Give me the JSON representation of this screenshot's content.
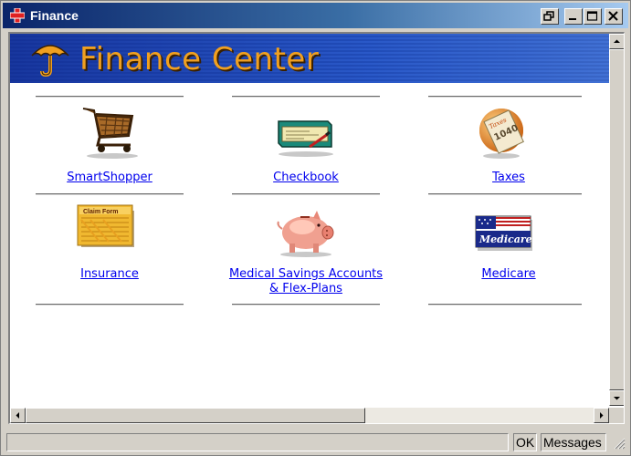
{
  "window": {
    "title": "Finance",
    "title_icon": "red-cross-icon",
    "controls": [
      "restore-icon",
      "minimize-icon",
      "maximize-icon",
      "close-icon"
    ]
  },
  "banner": {
    "title": "Finance Center",
    "icon": "umbrella-icon",
    "accent_color": "#f0a020",
    "background_color": "#2a58c8"
  },
  "items": [
    {
      "label": "SmartShopper",
      "icon": "shopping-cart-icon"
    },
    {
      "label": "Checkbook",
      "icon": "checkbook-icon"
    },
    {
      "label": "Taxes",
      "icon": "tax-form-icon"
    },
    {
      "label": "Insurance",
      "icon": "claim-form-icon"
    },
    {
      "label_line1": "Medical Savings Accounts",
      "label_line2": "& Flex-Plans",
      "icon": "piggy-bank-icon"
    },
    {
      "label": "Medicare",
      "icon": "medicare-card-icon"
    }
  ],
  "status": {
    "ok": "OK",
    "messages": "Messages"
  },
  "colors": {
    "link": "#0000ee",
    "chrome": "#d4d0c8",
    "titlebar": "#0a246a"
  }
}
